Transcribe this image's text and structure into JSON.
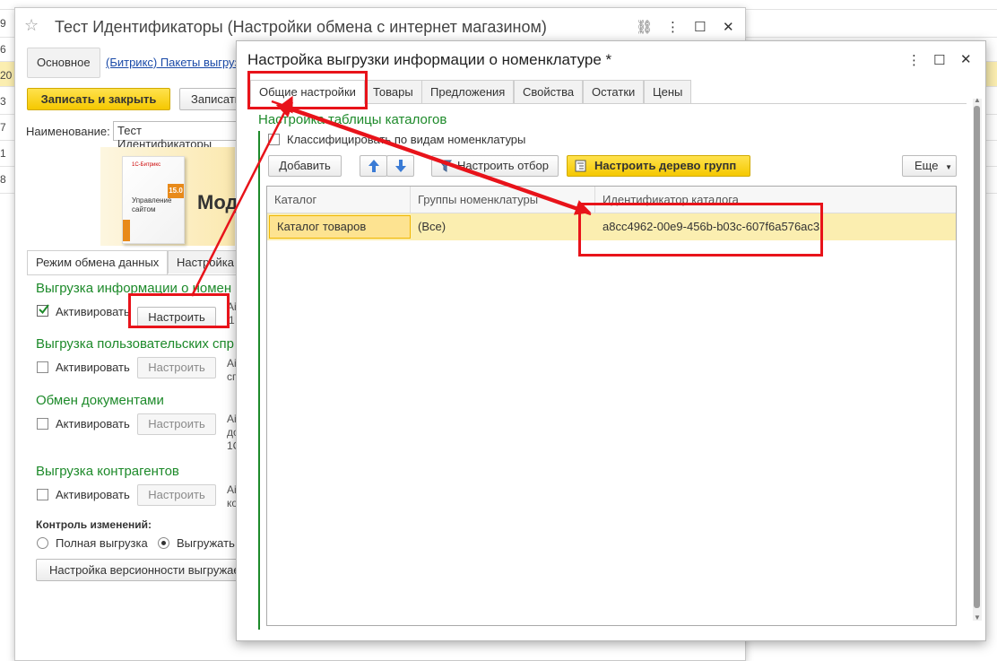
{
  "background": {
    "row_numbers": [
      "9",
      "6",
      "20",
      "3",
      "7",
      "1",
      "8"
    ]
  },
  "back_window": {
    "title": "Тест Идентификаторы (Настройки обмена с интернет магазином)",
    "star": "☆",
    "link_icon": "⛓",
    "more_icon": "⋮",
    "maximize_icon": "☐",
    "close_icon": "✕",
    "tab_main": "Основное",
    "tab_link": "(Битрикс) Пакеты выгруз",
    "btn_save_close": "Записать и закрыть",
    "btn_save": "Записать",
    "name_label": "Наименование:",
    "name_value": "Тест Идентификаторы",
    "banner_text": "Мод",
    "box_logo": "1С-Битрикс",
    "box_version": "15.0",
    "box_product": "Управление сайтом",
    "subtab_mode": "Режим обмена данных",
    "subtab_settings": "Настройка",
    "sections": [
      {
        "heading": "Выгрузка информации о номен",
        "check_label": "Активировать",
        "button": "Настроить",
        "checked": true,
        "side": "Ai",
        "side2": "1"
      },
      {
        "heading": "Выгрузка пользовательских спр",
        "check_label": "Активировать",
        "button": "Настроить",
        "checked": false,
        "side": "Ai",
        "side2": "сп"
      },
      {
        "heading": "Обмен документами",
        "check_label": "Активировать",
        "button": "Настроить",
        "checked": false,
        "side": "Ai",
        "side2": "до",
        "side3": "1С"
      },
      {
        "heading": "Выгрузка контрагентов",
        "check_label": "Активировать",
        "button": "Настроить",
        "checked": false,
        "side": "Ai",
        "side2": "ко"
      }
    ],
    "control_label": "Контроль изменений:",
    "radio_full": "Полная выгрузка",
    "radio_changes": "Выгружать",
    "btn_versioning": "Настройка версионности выгружае"
  },
  "dialog": {
    "title": "Настройка выгрузки информации о номенклатуре *",
    "more_icon": "⋮",
    "maximize_icon": "☐",
    "close_icon": "✕",
    "tabs": [
      "Общие настройки",
      "Товары",
      "Предложения",
      "Свойства",
      "Остатки",
      "Цены"
    ],
    "section_heading": "Настройка таблицы каталогов",
    "classify_label": "Классифицировать по видам номенклатуры",
    "btn_add": "Добавить",
    "btn_filter": "Настроить отбор",
    "btn_tree": "Настроить дерево групп",
    "btn_more": "Еще",
    "table": {
      "columns": [
        "Каталог",
        "Группы номенклатуры",
        "Идентификатор каталога"
      ],
      "rows": [
        [
          "Каталог товаров",
          "(Все)",
          "a8cc4962-00e9-456b-b03c-607f6a576ac3"
        ]
      ]
    }
  },
  "colors": {
    "accent_yellow": "#f5c800",
    "highlight_row": "#fbeeb0",
    "heading_green": "#1d8a2a",
    "annotation_red": "#e8131a"
  }
}
